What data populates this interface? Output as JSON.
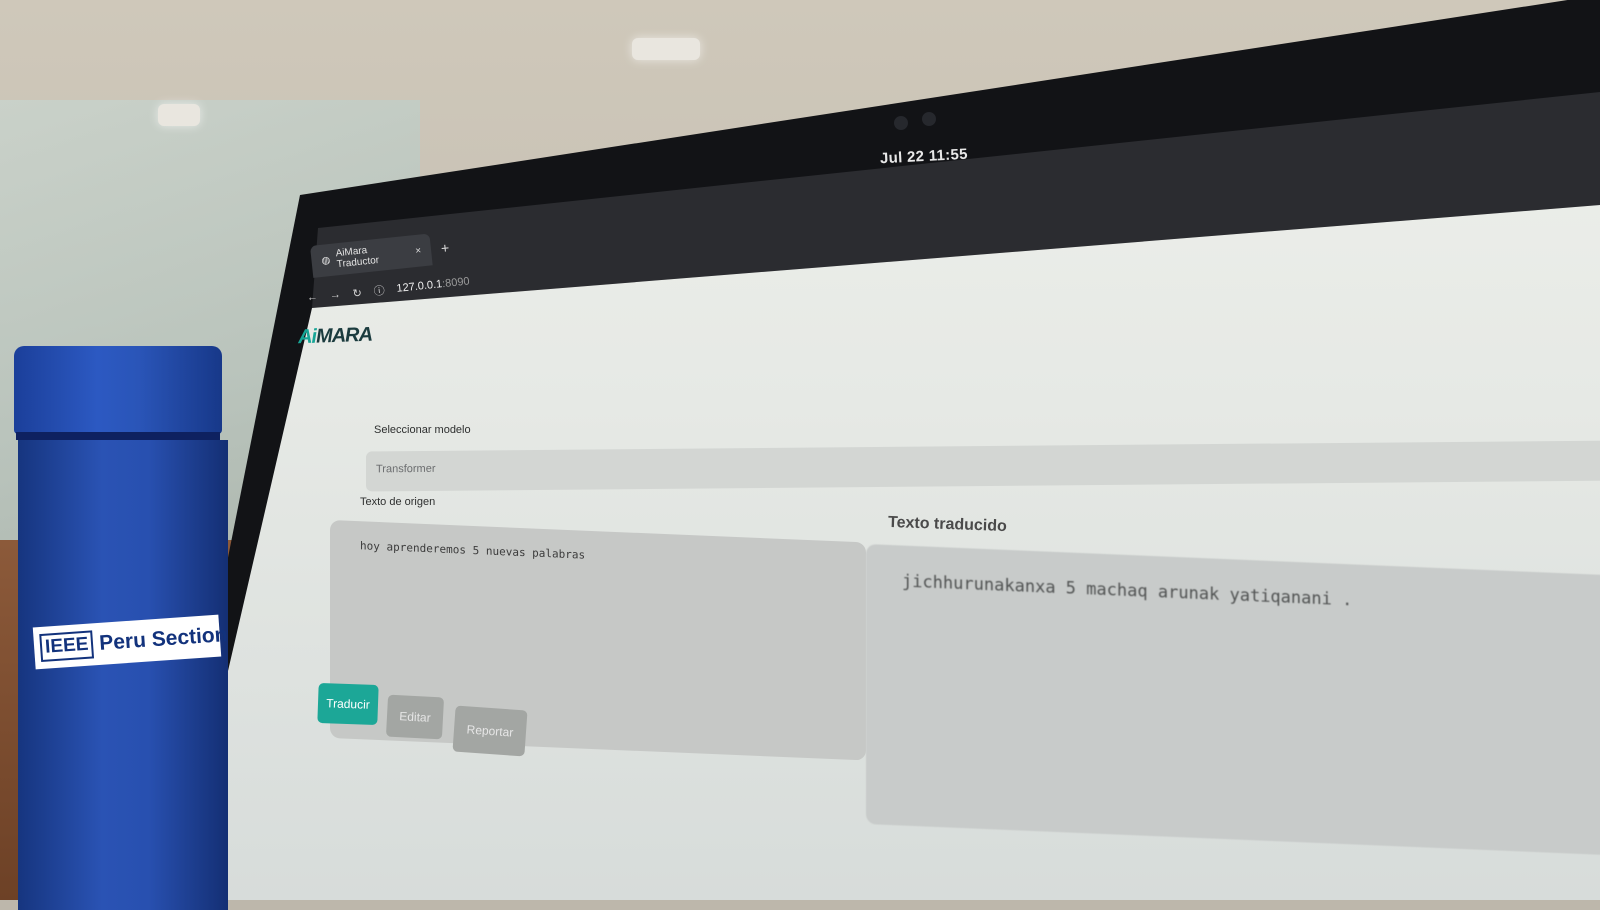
{
  "system_bar": {
    "clock": "Jul 22  11:55"
  },
  "browser": {
    "tab_title": "AiMara Traductor",
    "tab_close": "×",
    "new_tab": "+",
    "url_host": "127.0.0.1",
    "url_port": ":8090"
  },
  "app": {
    "logo_prefix": "Ai",
    "logo_rest": "MARA",
    "model_label": "Seleccionar modelo",
    "model_value": "Transformer",
    "source_label": "Texto de origen",
    "source_text": "hoy aprenderemos 5 nuevas palabras",
    "output_label": "Texto traducido",
    "output_text": "jichhurunakanxa 5 machaq arunak yatiqanani .",
    "buttons": {
      "translate": "Traducir",
      "edit": "Editar",
      "report": "Reportar"
    }
  },
  "bottle": {
    "brand": "IEEE",
    "section": "Peru Section"
  },
  "colors": {
    "accent": "#1ca797",
    "bottle_blue": "#2a53b4"
  }
}
